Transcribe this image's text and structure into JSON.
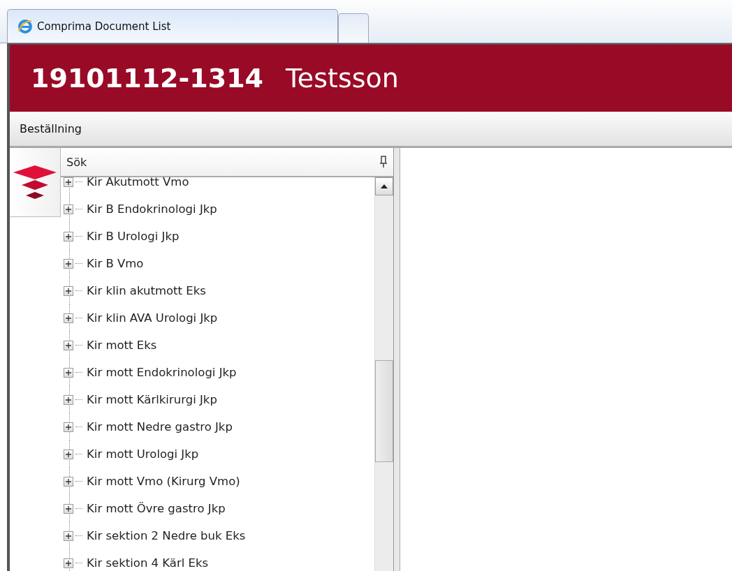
{
  "browser": {
    "tabs": [
      {
        "title": "Comprima Document List",
        "selected": true
      },
      {
        "selected": false
      }
    ]
  },
  "header": {
    "patient_id": "19101112-1314",
    "name": "Testsson"
  },
  "toolbar": {
    "items": [
      "Beställning"
    ]
  },
  "tree_panel": {
    "title": "Sök",
    "items": [
      {
        "label": "Kir Akutmott Vmo",
        "expanded": false
      },
      {
        "label": "Kir B Endokrinologi Jkp",
        "expanded": false
      },
      {
        "label": "Kir B Urologi Jkp",
        "expanded": false
      },
      {
        "label": "Kir B Vmo",
        "expanded": false
      },
      {
        "label": "Kir klin akutmott Eks",
        "expanded": false
      },
      {
        "label": "Kir klin AVA Urologi Jkp",
        "expanded": false
      },
      {
        "label": "Kir mott Eks",
        "expanded": false
      },
      {
        "label": "Kir mott Endokrinologi Jkp",
        "expanded": false
      },
      {
        "label": "Kir mott Kärlkirurgi Jkp",
        "expanded": false
      },
      {
        "label": "Kir mott Nedre gastro Jkp",
        "expanded": false
      },
      {
        "label": "Kir mott Urologi Jkp",
        "expanded": false
      },
      {
        "label": "Kir mott Vmo (Kirurg Vmo)",
        "expanded": false
      },
      {
        "label": "Kir mott Övre gastro Jkp",
        "expanded": false
      },
      {
        "label": "Kir sektion 2 Nedre buk Eks",
        "expanded": false
      },
      {
        "label": "Kir sektion 4 Kärl Eks",
        "expanded": false
      }
    ]
  }
}
